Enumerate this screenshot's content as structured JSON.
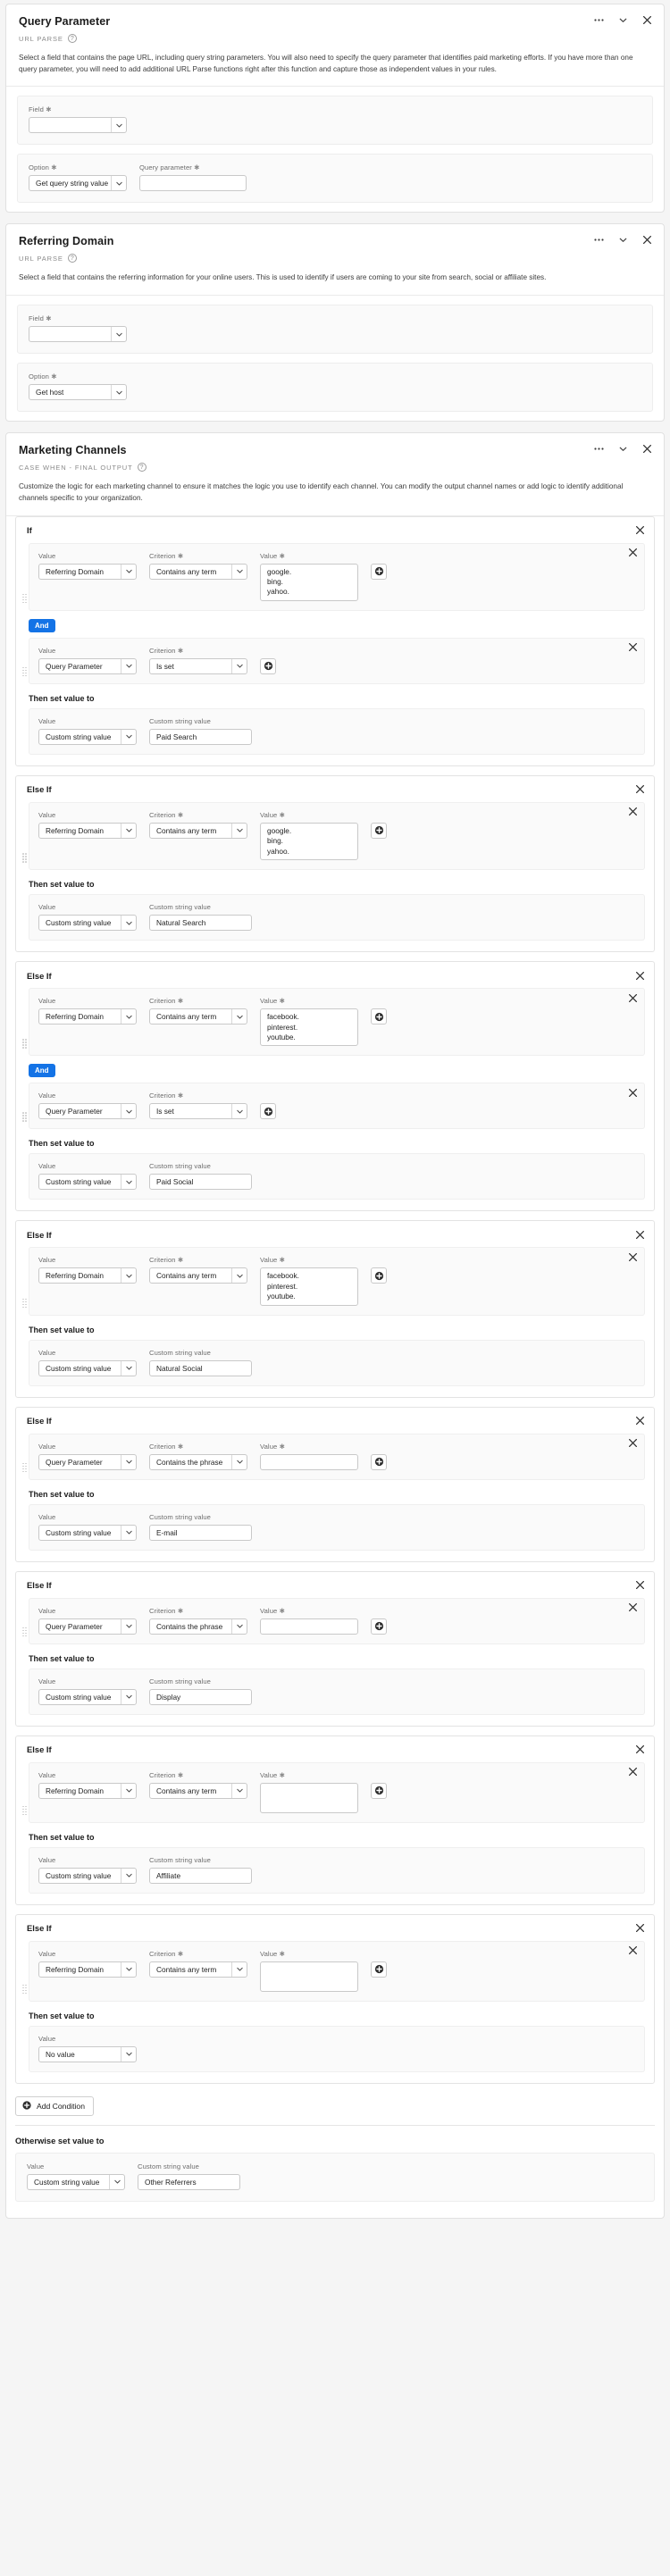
{
  "icons": {
    "more": "ellipsis-icon",
    "collapse": "chevron-down-icon",
    "close": "close-icon",
    "help": "?",
    "add": "plus-circle-icon"
  },
  "cards": [
    {
      "title": "Query Parameter",
      "subtitle": "URL PARSE",
      "description": "Select a field that contains the page URL, including query string parameters. You will also need to specify the query parameter that identifies paid marketing efforts. If you have more than one query parameter, you will need to add additional URL Parse functions right after this function and capture those as independent values in your rules."
    },
    {
      "title": "Referring Domain",
      "subtitle": "URL PARSE",
      "description": "Select a field that contains the referring information for your online users. This is used to identify if users are coming to your site from search, social or affiliate sites."
    },
    {
      "title": "Marketing Channels",
      "subtitle": "CASE WHEN - FINAL OUTPUT",
      "description": "Customize the logic for each marketing channel to ensure it matches the logic you use to identify each channel. You can modify the output channel names or add logic to identify additional channels specific to your organization."
    }
  ],
  "query_parameter_form": {
    "field_label": "Field",
    "field_value": "",
    "option_label": "Option",
    "option_value": "Get query string value",
    "query_parameter_label": "Query parameter",
    "query_parameter_value": ""
  },
  "referring_domain_form": {
    "field_label": "Field",
    "field_value": "",
    "option_label": "Option",
    "option_value": "Get host"
  },
  "labels": {
    "value": "Value",
    "criterion": "Criterion",
    "custom_string_value": "Custom string value",
    "then_set_value_to": "Then set value to",
    "otherwise_set_value_to": "Otherwise set value to",
    "and": "And",
    "add_condition": "Add Condition",
    "if": "If",
    "else_if": "Else If"
  },
  "conditions": [
    {
      "header": "If",
      "rows": [
        {
          "value": "Referring Domain",
          "criterion": "Contains any term",
          "match": "google.\nbing.\nyahoo.",
          "type": "textarea"
        },
        {
          "connector": "And",
          "value": "Query Parameter",
          "criterion": "Is set",
          "match": "",
          "type": "none"
        }
      ],
      "then_type": "custom",
      "then_value_select": "Custom string value",
      "then_custom_value": "Paid Search"
    },
    {
      "header": "Else If",
      "rows": [
        {
          "value": "Referring Domain",
          "criterion": "Contains any term",
          "match": "google.\nbing.\nyahoo.",
          "type": "textarea"
        }
      ],
      "then_type": "custom",
      "then_value_select": "Custom string value",
      "then_custom_value": "Natural Search"
    },
    {
      "header": "Else If",
      "rows": [
        {
          "value": "Referring Domain",
          "criterion": "Contains any term",
          "match": "facebook.\npinterest.\nyoutube.",
          "type": "textarea"
        },
        {
          "connector": "And",
          "value": "Query Parameter",
          "criterion": "Is set",
          "match": "",
          "type": "none"
        }
      ],
      "then_type": "custom",
      "then_value_select": "Custom string value",
      "then_custom_value": "Paid Social"
    },
    {
      "header": "Else If",
      "rows": [
        {
          "value": "Referring Domain",
          "criterion": "Contains any term",
          "match": "facebook.\npinterest.\nyoutube.",
          "type": "textarea"
        }
      ],
      "then_type": "custom",
      "then_value_select": "Custom string value",
      "then_custom_value": "Natural Social"
    },
    {
      "header": "Else If",
      "rows": [
        {
          "value": "Query Parameter",
          "criterion": "Contains the phrase",
          "match": "",
          "type": "input"
        }
      ],
      "then_type": "custom",
      "then_value_select": "Custom string value",
      "then_custom_value": "E-mail"
    },
    {
      "header": "Else If",
      "rows": [
        {
          "value": "Query Parameter",
          "criterion": "Contains the phrase",
          "match": "",
          "type": "input"
        }
      ],
      "then_type": "custom",
      "then_value_select": "Custom string value",
      "then_custom_value": "Display"
    },
    {
      "header": "Else If",
      "rows": [
        {
          "value": "Referring Domain",
          "criterion": "Contains any term",
          "match": "",
          "type": "textarea"
        }
      ],
      "then_type": "custom",
      "then_value_select": "Custom string value",
      "then_custom_value": "Affiliate"
    },
    {
      "header": "Else If",
      "rows": [
        {
          "value": "Referring Domain",
          "criterion": "Contains any term",
          "match": "",
          "type": "textarea"
        }
      ],
      "then_type": "novalue",
      "then_value_select": "No value",
      "then_custom_value": ""
    }
  ],
  "otherwise": {
    "value_label": "Value",
    "value_select": "Custom string value",
    "custom_label": "Custom string value",
    "custom_value": "Other Referrers"
  },
  "colors": {
    "accent_blue": "#1473e6",
    "card_bg": "#ffffff",
    "page_bg": "#f5f5f5",
    "panel_bg": "#fafafa"
  }
}
